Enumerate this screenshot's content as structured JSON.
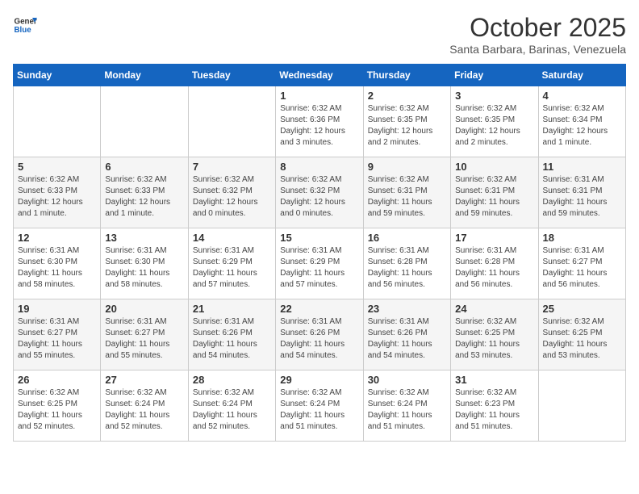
{
  "header": {
    "logo_general": "General",
    "logo_blue": "Blue",
    "month": "October 2025",
    "location": "Santa Barbara, Barinas, Venezuela"
  },
  "days_of_week": [
    "Sunday",
    "Monday",
    "Tuesday",
    "Wednesday",
    "Thursday",
    "Friday",
    "Saturday"
  ],
  "weeks": [
    {
      "cells": [
        {
          "day": "",
          "content": ""
        },
        {
          "day": "",
          "content": ""
        },
        {
          "day": "",
          "content": ""
        },
        {
          "day": "1",
          "content": "Sunrise: 6:32 AM\nSunset: 6:36 PM\nDaylight: 12 hours and 3 minutes."
        },
        {
          "day": "2",
          "content": "Sunrise: 6:32 AM\nSunset: 6:35 PM\nDaylight: 12 hours and 2 minutes."
        },
        {
          "day": "3",
          "content": "Sunrise: 6:32 AM\nSunset: 6:35 PM\nDaylight: 12 hours and 2 minutes."
        },
        {
          "day": "4",
          "content": "Sunrise: 6:32 AM\nSunset: 6:34 PM\nDaylight: 12 hours and 1 minute."
        }
      ]
    },
    {
      "cells": [
        {
          "day": "5",
          "content": "Sunrise: 6:32 AM\nSunset: 6:33 PM\nDaylight: 12 hours and 1 minute."
        },
        {
          "day": "6",
          "content": "Sunrise: 6:32 AM\nSunset: 6:33 PM\nDaylight: 12 hours and 1 minute."
        },
        {
          "day": "7",
          "content": "Sunrise: 6:32 AM\nSunset: 6:32 PM\nDaylight: 12 hours and 0 minutes."
        },
        {
          "day": "8",
          "content": "Sunrise: 6:32 AM\nSunset: 6:32 PM\nDaylight: 12 hours and 0 minutes."
        },
        {
          "day": "9",
          "content": "Sunrise: 6:32 AM\nSunset: 6:31 PM\nDaylight: 11 hours and 59 minutes."
        },
        {
          "day": "10",
          "content": "Sunrise: 6:32 AM\nSunset: 6:31 PM\nDaylight: 11 hours and 59 minutes."
        },
        {
          "day": "11",
          "content": "Sunrise: 6:31 AM\nSunset: 6:31 PM\nDaylight: 11 hours and 59 minutes."
        }
      ]
    },
    {
      "cells": [
        {
          "day": "12",
          "content": "Sunrise: 6:31 AM\nSunset: 6:30 PM\nDaylight: 11 hours and 58 minutes."
        },
        {
          "day": "13",
          "content": "Sunrise: 6:31 AM\nSunset: 6:30 PM\nDaylight: 11 hours and 58 minutes."
        },
        {
          "day": "14",
          "content": "Sunrise: 6:31 AM\nSunset: 6:29 PM\nDaylight: 11 hours and 57 minutes."
        },
        {
          "day": "15",
          "content": "Sunrise: 6:31 AM\nSunset: 6:29 PM\nDaylight: 11 hours and 57 minutes."
        },
        {
          "day": "16",
          "content": "Sunrise: 6:31 AM\nSunset: 6:28 PM\nDaylight: 11 hours and 56 minutes."
        },
        {
          "day": "17",
          "content": "Sunrise: 6:31 AM\nSunset: 6:28 PM\nDaylight: 11 hours and 56 minutes."
        },
        {
          "day": "18",
          "content": "Sunrise: 6:31 AM\nSunset: 6:27 PM\nDaylight: 11 hours and 56 minutes."
        }
      ]
    },
    {
      "cells": [
        {
          "day": "19",
          "content": "Sunrise: 6:31 AM\nSunset: 6:27 PM\nDaylight: 11 hours and 55 minutes."
        },
        {
          "day": "20",
          "content": "Sunrise: 6:31 AM\nSunset: 6:27 PM\nDaylight: 11 hours and 55 minutes."
        },
        {
          "day": "21",
          "content": "Sunrise: 6:31 AM\nSunset: 6:26 PM\nDaylight: 11 hours and 54 minutes."
        },
        {
          "day": "22",
          "content": "Sunrise: 6:31 AM\nSunset: 6:26 PM\nDaylight: 11 hours and 54 minutes."
        },
        {
          "day": "23",
          "content": "Sunrise: 6:31 AM\nSunset: 6:26 PM\nDaylight: 11 hours and 54 minutes."
        },
        {
          "day": "24",
          "content": "Sunrise: 6:32 AM\nSunset: 6:25 PM\nDaylight: 11 hours and 53 minutes."
        },
        {
          "day": "25",
          "content": "Sunrise: 6:32 AM\nSunset: 6:25 PM\nDaylight: 11 hours and 53 minutes."
        }
      ]
    },
    {
      "cells": [
        {
          "day": "26",
          "content": "Sunrise: 6:32 AM\nSunset: 6:25 PM\nDaylight: 11 hours and 52 minutes."
        },
        {
          "day": "27",
          "content": "Sunrise: 6:32 AM\nSunset: 6:24 PM\nDaylight: 11 hours and 52 minutes."
        },
        {
          "day": "28",
          "content": "Sunrise: 6:32 AM\nSunset: 6:24 PM\nDaylight: 11 hours and 52 minutes."
        },
        {
          "day": "29",
          "content": "Sunrise: 6:32 AM\nSunset: 6:24 PM\nDaylight: 11 hours and 51 minutes."
        },
        {
          "day": "30",
          "content": "Sunrise: 6:32 AM\nSunset: 6:24 PM\nDaylight: 11 hours and 51 minutes."
        },
        {
          "day": "31",
          "content": "Sunrise: 6:32 AM\nSunset: 6:23 PM\nDaylight: 11 hours and 51 minutes."
        },
        {
          "day": "",
          "content": ""
        }
      ]
    }
  ]
}
